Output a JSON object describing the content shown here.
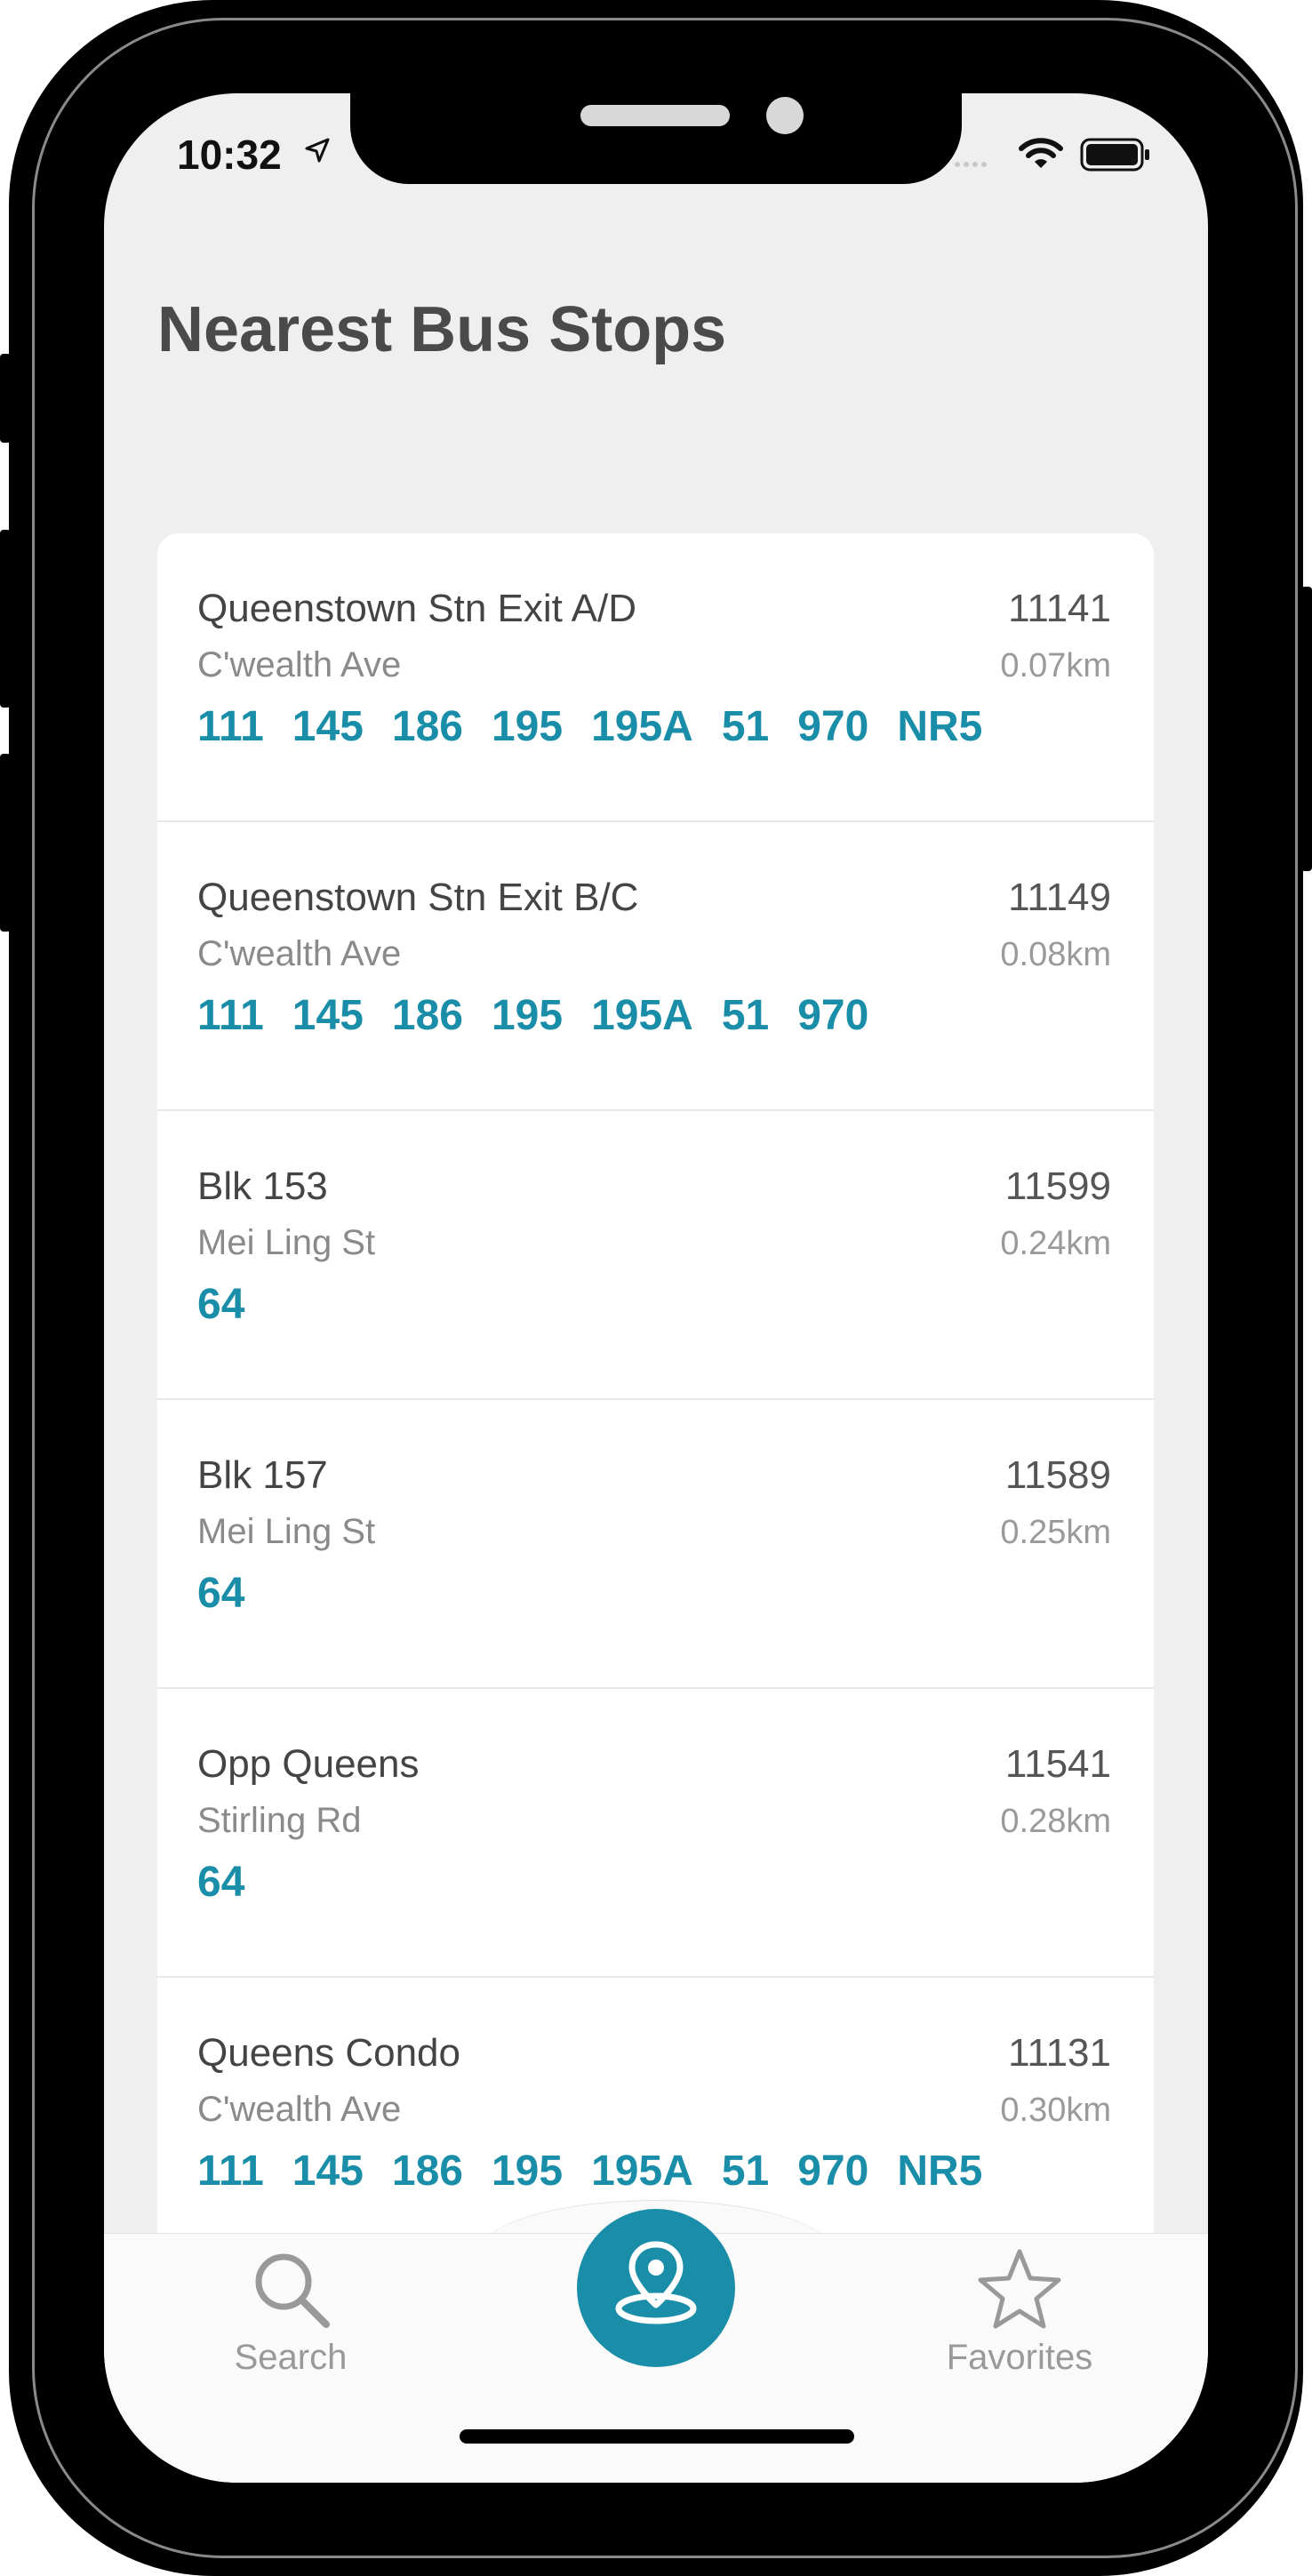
{
  "status_bar": {
    "time": "10:32"
  },
  "page": {
    "title": "Nearest Bus Stops"
  },
  "stops": [
    {
      "name": "Queenstown Stn Exit A/D",
      "code": "11141",
      "road": "C'wealth Ave",
      "distance": "0.07km",
      "services": [
        "111",
        "145",
        "186",
        "195",
        "195A",
        "51",
        "970",
        "NR5"
      ]
    },
    {
      "name": "Queenstown Stn Exit B/C",
      "code": "11149",
      "road": "C'wealth Ave",
      "distance": "0.08km",
      "services": [
        "111",
        "145",
        "186",
        "195",
        "195A",
        "51",
        "970"
      ]
    },
    {
      "name": "Blk 153",
      "code": "11599",
      "road": "Mei Ling St",
      "distance": "0.24km",
      "services": [
        "64"
      ]
    },
    {
      "name": "Blk 157",
      "code": "11589",
      "road": "Mei Ling St",
      "distance": "0.25km",
      "services": [
        "64"
      ]
    },
    {
      "name": "Opp Queens",
      "code": "11541",
      "road": "Stirling Rd",
      "distance": "0.28km",
      "services": [
        "64"
      ]
    },
    {
      "name": "Queens Condo",
      "code": "11131",
      "road": "C'wealth Ave",
      "distance": "0.30km",
      "services": [
        "111",
        "145",
        "186",
        "195",
        "195A",
        "51",
        "970",
        "NR5"
      ]
    }
  ],
  "tabbar": {
    "search_label": "Search",
    "favorites_label": "Favorites",
    "search_icon": "search-icon",
    "nearby_icon": "location-pin-icon",
    "favorites_icon": "star-icon"
  },
  "colors": {
    "accent": "#1a8ea8",
    "background": "#efefef"
  }
}
